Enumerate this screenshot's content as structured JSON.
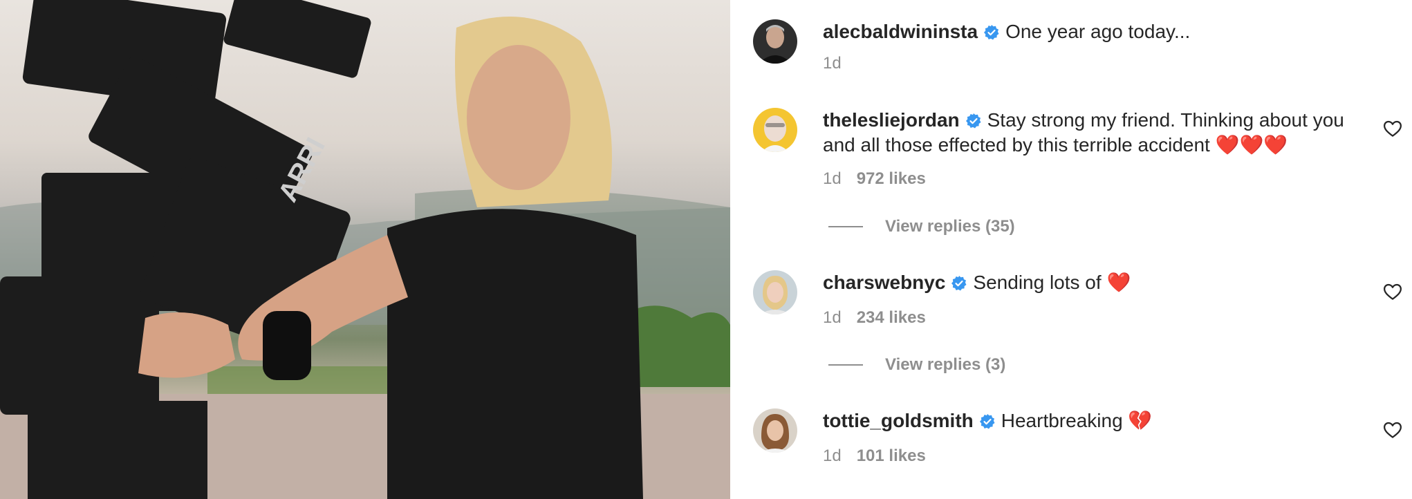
{
  "photo": {
    "brand_text": "ARRI"
  },
  "caption": {
    "username": "alecbaldwininsta",
    "text": "One year ago today...",
    "time": "1d"
  },
  "comments": [
    {
      "username": "theleslie jordan",
      "display_username": "theleslie jordan",
      "text_line1": "Stay strong my friend. Thinking about you",
      "text_line2": "and all those effected by this terrible accident ❤️❤️❤️",
      "time": "1d",
      "likes": "972 likes",
      "replies": "View replies (35)"
    },
    {
      "username": "charswebnyc",
      "text": "Sending lots of ❤️",
      "time": "1d",
      "likes": "234 likes",
      "replies": "View replies (3)"
    },
    {
      "username": "tottie_goldsmith",
      "text": "Heartbreaking 💔",
      "time": "1d",
      "likes": "101 likes"
    }
  ],
  "colors": {
    "verified": "#3897f0",
    "secondary": "#8e8e8e",
    "text": "#262626"
  },
  "icons": {
    "verified": "verified-badge-icon",
    "like": "heart-outline-icon"
  }
}
